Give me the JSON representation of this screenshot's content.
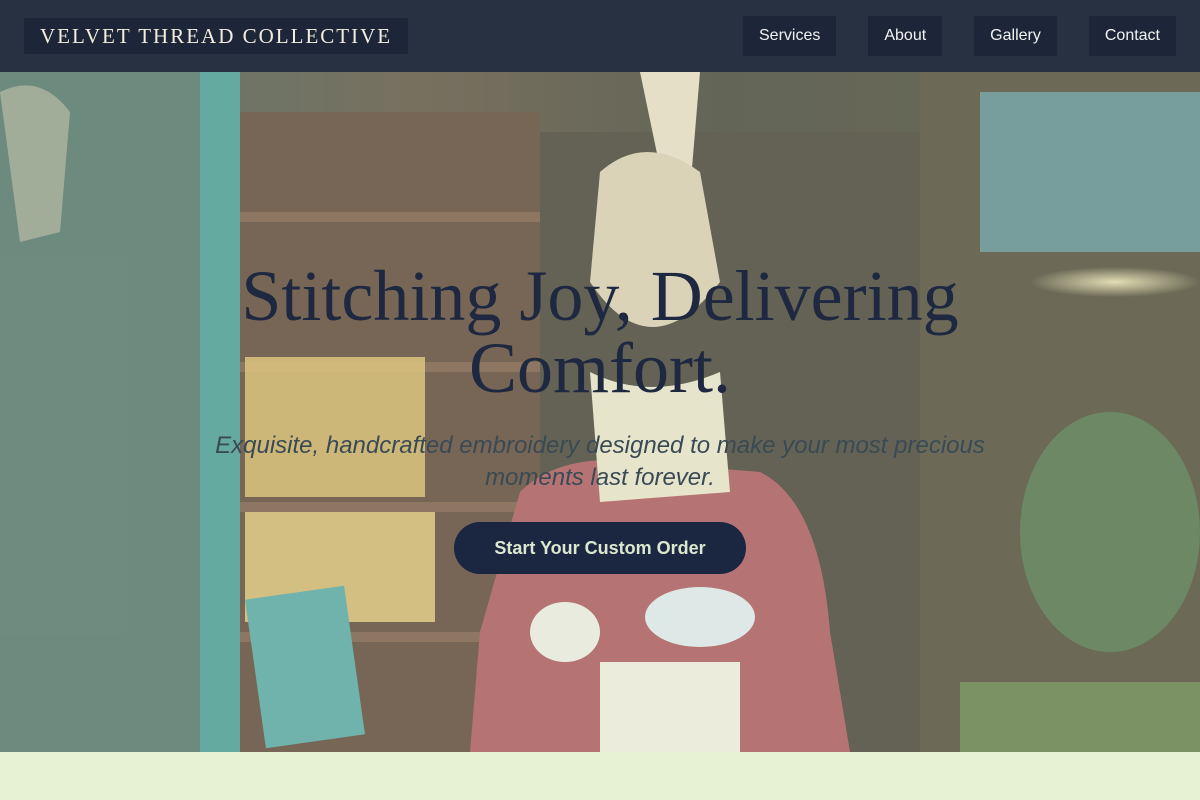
{
  "brand": {
    "name": "VELVET THREAD COLLECTIVE"
  },
  "nav": {
    "items": [
      "Services",
      "About",
      "Gallery",
      "Contact"
    ]
  },
  "hero": {
    "headline": "Stitching Joy, Delivering Comfort.",
    "subheadline": "Exquisite, handcrafted embroidery designed to make your most precious moments last forever.",
    "cta_label": "Start Your Custom Order",
    "image_subject": "rabbit-figure-shop-photo"
  },
  "colors": {
    "header_bg": "#283142",
    "nav_button_bg": "#1c2638",
    "headline": "#1e2840",
    "cta_bg": "#1b2640",
    "cta_text": "#dbe8cf",
    "section_bg": "#e6f2d3"
  }
}
